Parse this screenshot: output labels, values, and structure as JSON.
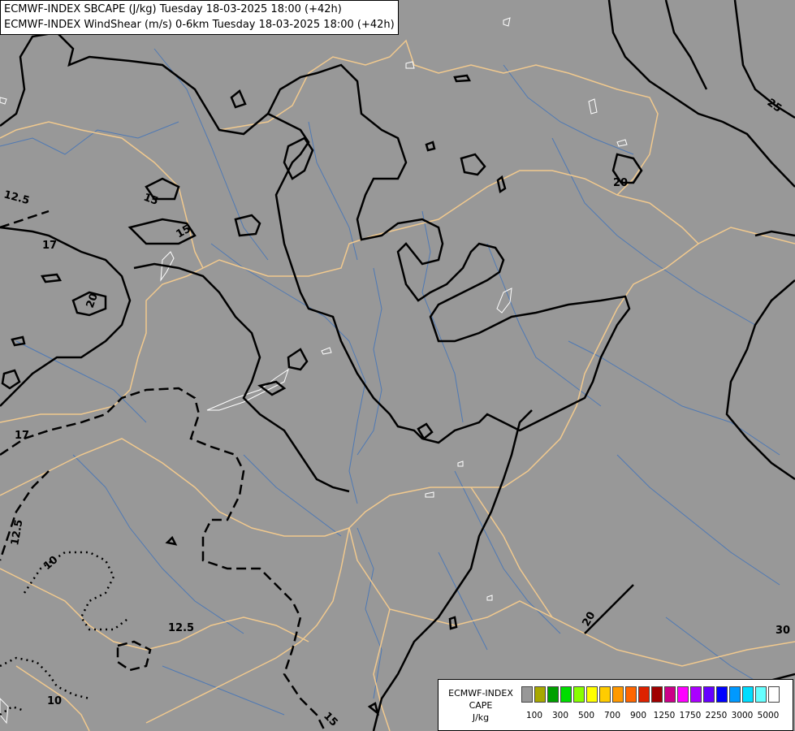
{
  "titles": {
    "line1": "ECMWF-INDEX SBCAPE (J/kg) Tuesday 18-03-2025 18:00 (+42h)",
    "line2": "ECMWF-INDEX WindShear  (m/s) 0-6km Tuesday 18-03-2025 18:00 (+42h)"
  },
  "contour_labels": [
    "12.5",
    "15",
    "15",
    "17",
    "20",
    "20",
    "25",
    "17",
    "12.5",
    "10",
    "12.5",
    "10",
    "15",
    "20",
    "30"
  ],
  "legend": {
    "title_lines": [
      "ECMWF-INDEX",
      "CAPE",
      "J/kg"
    ],
    "colors": [
      "#989898",
      "#a8a800",
      "#00a000",
      "#00dd00",
      "#88ff00",
      "#ffff00",
      "#ffcc00",
      "#ff9900",
      "#ff6600",
      "#dd2200",
      "#a00000",
      "#cc0088",
      "#ff00ff",
      "#aa00ff",
      "#6600ff",
      "#0000ff",
      "#0099ff",
      "#00ddff",
      "#66ffff",
      "#ffffff"
    ],
    "ticks": [
      "100",
      "300",
      "500",
      "700",
      "900",
      "1250",
      "1750",
      "2250",
      "3000",
      "5000"
    ]
  },
  "map_colors": {
    "background": "#989898",
    "borders": "#f1c98e",
    "rivers": "#4f79b4",
    "contours": "#000000",
    "cape_outline": "#ffffff"
  }
}
